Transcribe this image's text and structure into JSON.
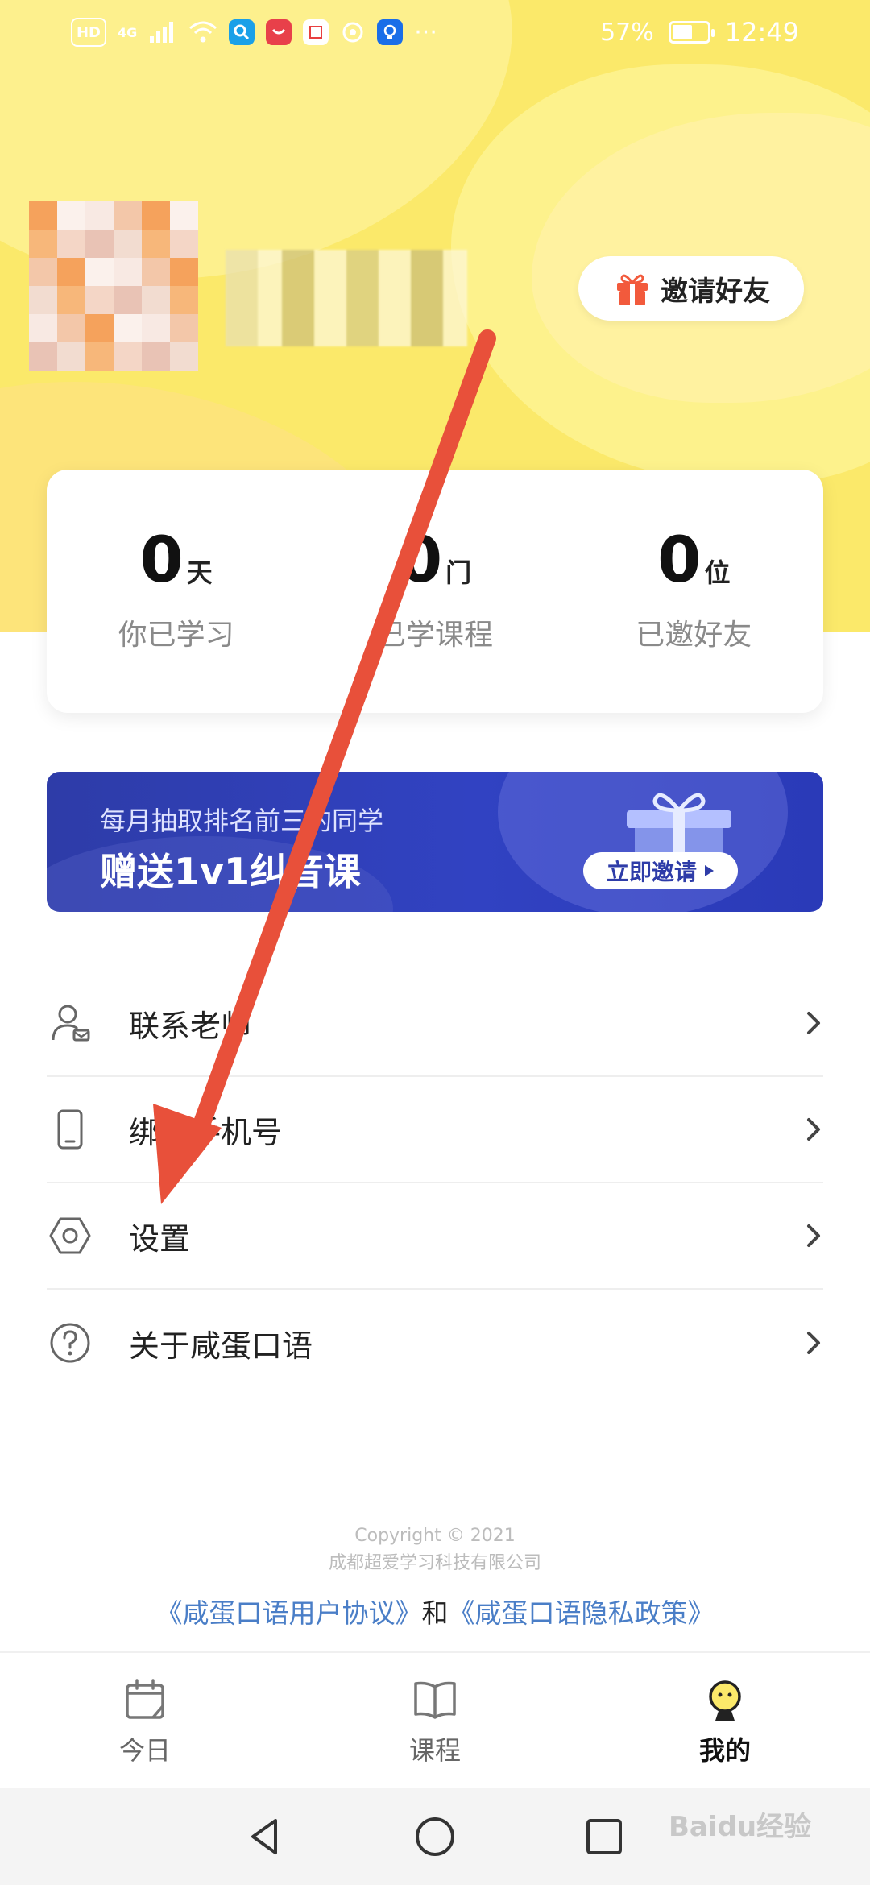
{
  "status_bar": {
    "network": "HD",
    "signal_label": "4G",
    "battery_percent": "57%",
    "battery_level": 0.57,
    "time": "12:49",
    "notification_icons": [
      "search-app-icon",
      "huawei-app-icon",
      "doc-app-icon",
      "gallery-app-icon",
      "bulb-app-icon"
    ],
    "more": "···"
  },
  "profile": {
    "invite_button_label": "邀请好友"
  },
  "stats": [
    {
      "value": "0",
      "unit": "天",
      "label": "你已学习"
    },
    {
      "value": "0",
      "unit": "门",
      "label": "已学课程"
    },
    {
      "value": "0",
      "unit": "位",
      "label": "已邀好友"
    }
  ],
  "banner": {
    "line1": "每月抽取排名前三的同学",
    "line2": "赠送1v1纠音课",
    "button_label": "立即邀请"
  },
  "menu": [
    {
      "label": "联系老师",
      "icon": "teacher-contact-icon"
    },
    {
      "label": "绑定手机号",
      "icon": "phone-icon"
    },
    {
      "label": "设置",
      "icon": "settings-icon"
    },
    {
      "label": "关于咸蛋口语",
      "icon": "help-icon"
    }
  ],
  "footer": {
    "copyright": "Copyright © 2021",
    "company": "成都超爱学习科技有限公司",
    "link_agreement": "《咸蛋口语用户协议》",
    "and": "和",
    "link_privacy": "《咸蛋口语隐私政策》"
  },
  "tabs": [
    {
      "label": "今日",
      "icon": "calendar-icon",
      "active": false
    },
    {
      "label": "课程",
      "icon": "book-icon",
      "active": false
    },
    {
      "label": "我的",
      "icon": "profile-mascot-icon",
      "active": true
    }
  ],
  "watermark": "Baidu经验",
  "colors": {
    "accent_yellow": "#fbe96a",
    "banner_blue": "#3142c2",
    "link_blue": "#4a7ec7",
    "annotation_red": "#e8503a"
  }
}
